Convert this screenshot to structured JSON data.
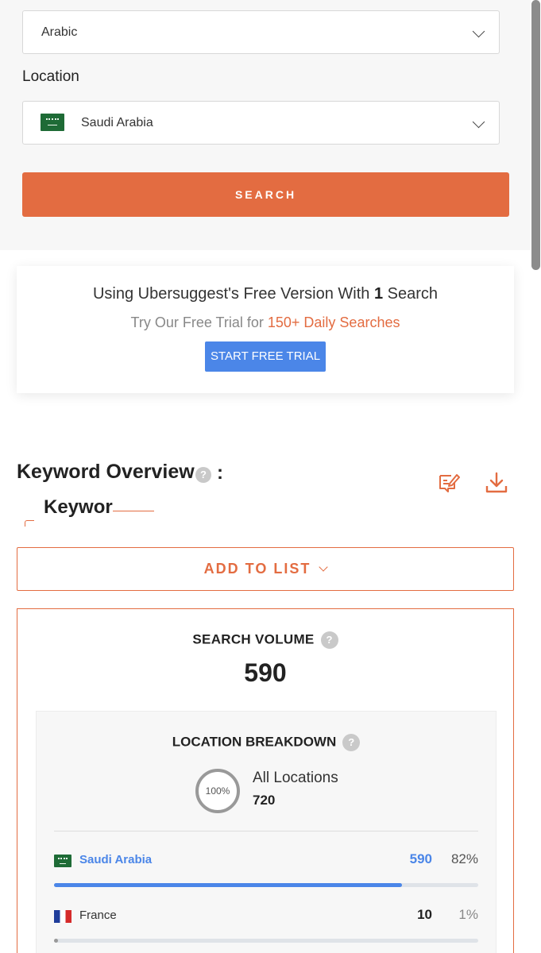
{
  "language_select": {
    "value": "Arabic"
  },
  "location": {
    "label": "Location",
    "value": "Saudi Arabia"
  },
  "search_button": {
    "label": "SEARCH"
  },
  "promo": {
    "line1_prefix": "Using Ubersuggest's Free Version With ",
    "line1_count": "1",
    "line1_suffix": " Search",
    "line2_prefix": "Try Our Free Trial for ",
    "line2_highlight": "150+ Daily Searches",
    "button": "START FREE TRIAL"
  },
  "keyword_overview": {
    "title": "Keyword Overview",
    "help": "?",
    "colon": ":",
    "keyword": "Keywor",
    "add_to_list": "ADD TO LIST"
  },
  "search_volume": {
    "title": "SEARCH VOLUME",
    "help": "?",
    "value": "590"
  },
  "location_breakdown": {
    "title": "LOCATION BREAKDOWN",
    "help": "?",
    "ring_label": "100%",
    "all_label": "All Locations",
    "all_value": "720",
    "rows": [
      {
        "name": "Saudi Arabia",
        "value": "590",
        "percent": "82%",
        "share": 0.82,
        "color": "#4b86e8"
      },
      {
        "name": "France",
        "value": "10",
        "percent": "1%",
        "share": 0.01,
        "color": "#999999"
      }
    ]
  },
  "colors": {
    "accent": "#e36c41",
    "primary_blue": "#4b86e8"
  }
}
